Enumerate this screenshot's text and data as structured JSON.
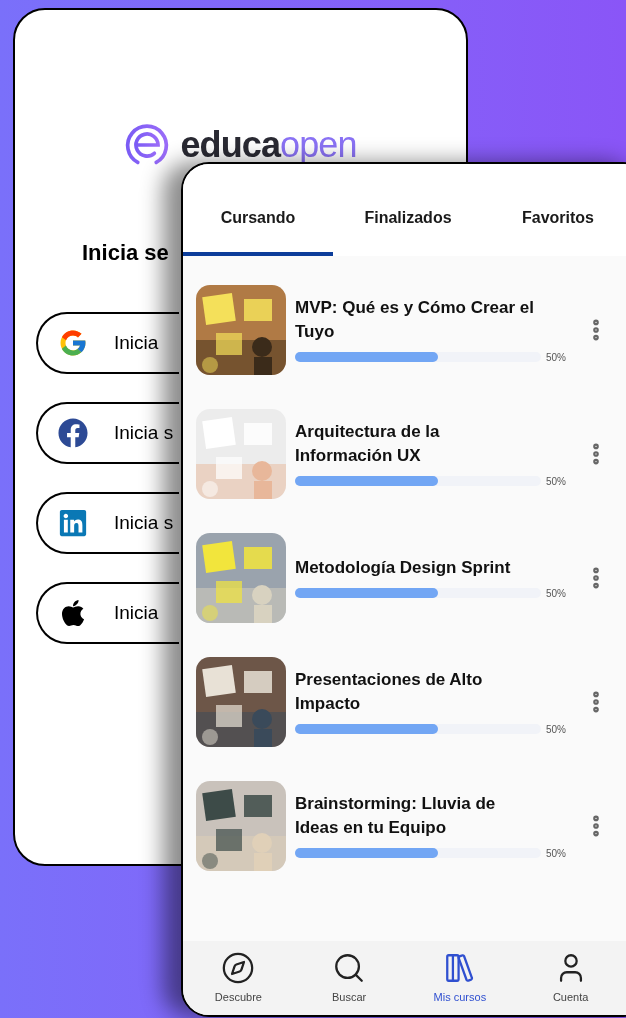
{
  "login_screen": {
    "logo": {
      "dark_part": "educa",
      "light_part": "open"
    },
    "heading": "Inicia se",
    "buttons": [
      {
        "kind": "google",
        "label": "Inicia"
      },
      {
        "kind": "facebook",
        "label": "Inicia s"
      },
      {
        "kind": "linkedin",
        "label": "Inicia s"
      },
      {
        "kind": "apple",
        "label": "Inicia"
      }
    ]
  },
  "courses_screen": {
    "tabs": [
      {
        "label": "Cursando",
        "selected": true
      },
      {
        "label": "Finalizados",
        "selected": false
      },
      {
        "label": "Favoritos",
        "selected": false
      }
    ],
    "courses": [
      {
        "title": "MVP: Qué es y Cómo Crear el Tuyo",
        "level": 0.58,
        "reading": "50%"
      },
      {
        "title": "Arquitectura de la Información UX",
        "level": 0.58,
        "reading": "50%"
      },
      {
        "title": "Metodología Design Sprint",
        "level": 0.58,
        "reading": "50%"
      },
      {
        "title": "Presentaciones de Alto Impacto",
        "level": 0.58,
        "reading": "50%"
      },
      {
        "title": "Brainstorming: Lluvia de Ideas en tu Equipo",
        "level": 0.58,
        "reading": "50%"
      }
    ],
    "bottom_nav": [
      {
        "label": "Descubre",
        "selected": false
      },
      {
        "label": "Buscar",
        "selected": false
      },
      {
        "label": "Mis cursos",
        "selected": true
      },
      {
        "label": "Cuenta",
        "selected": false
      }
    ]
  }
}
